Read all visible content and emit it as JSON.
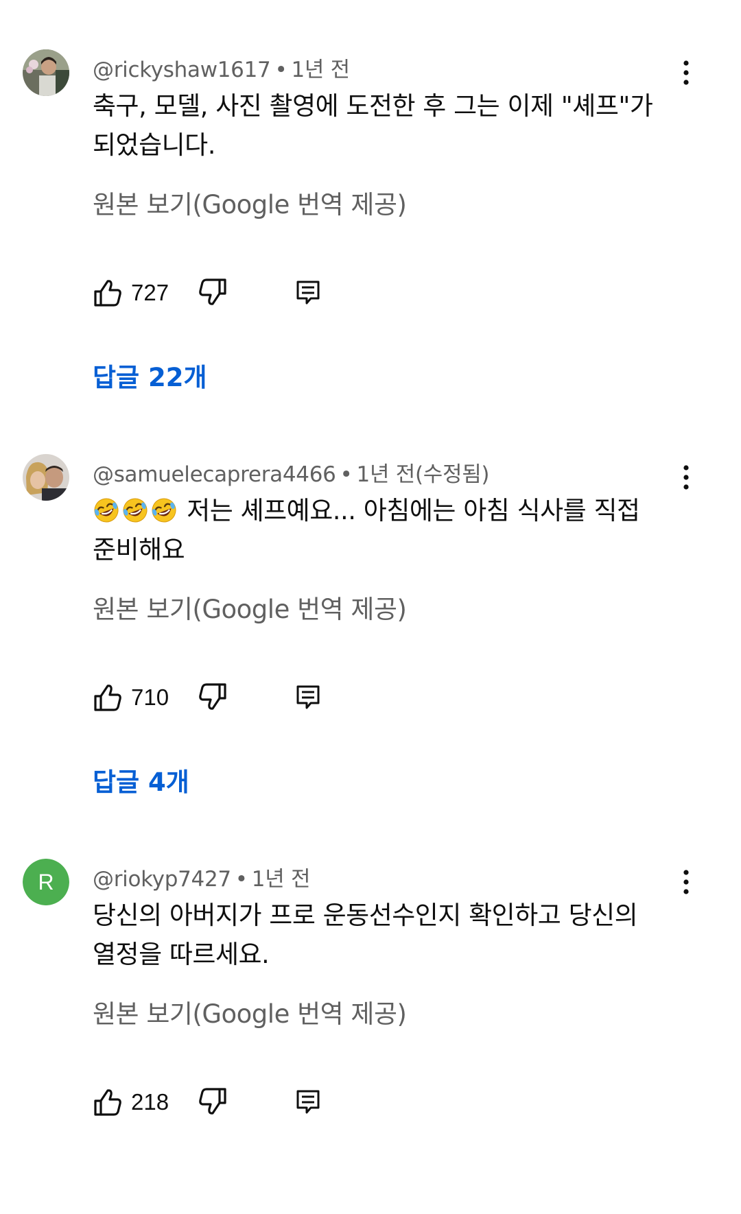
{
  "comments": [
    {
      "author": "@rickyshaw1617",
      "time": "1년 전",
      "text": "축구, 모델, 사진 촬영에 도전한 후 그는 이제 \"셰프\"가 되었습니다.",
      "translate_label": "원본 보기(Google 번역 제공)",
      "likes": "727",
      "replies_label": "답글 22개",
      "avatar": "photo"
    },
    {
      "author": "@samuelecaprera4466",
      "time": "1년 전(수정됨)",
      "emoji_count": 3,
      "emoji": "rolling-on-floor-laughing-emoji",
      "text": " 저는 셰프예요... 아침에는 아침 식사를 직접 준비해요",
      "translate_label": "원본 보기(Google 번역 제공)",
      "likes": "710",
      "replies_label": "답글 4개",
      "avatar": "photo"
    },
    {
      "author": "@riokyp7427",
      "time": "1년 전",
      "text": "당신의 아버지가 프로 운동선수인지 확인하고 당신의 열정을 따르세요.",
      "translate_label": "원본 보기(Google 번역 제공)",
      "likes": "218",
      "avatar_letter": "R",
      "avatar_color": "#4caf50"
    }
  ],
  "colors": {
    "link": "#065fd4",
    "secondary_text": "#606060",
    "primary_text": "#0f0f0f"
  },
  "icons": {
    "like": "thumb-up-icon",
    "dislike": "thumb-down-icon",
    "reply": "comment-reply-icon",
    "more": "more-vertical-icon"
  }
}
